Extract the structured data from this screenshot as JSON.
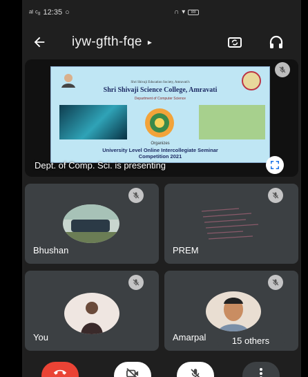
{
  "status_bar": {
    "signal": "ᵃᴵ ᶜₗₗ",
    "time": "12:35",
    "battery": "88"
  },
  "meeting": {
    "code": "iyw-gfth-fqe",
    "caret": "▸"
  },
  "presentation": {
    "presenter_label": "Dept. of Comp. Sci. is presenting",
    "slide": {
      "society": "Shri Shivaji Education Society, Amravati's",
      "college": "Shri Shivaji Science College, Amravati",
      "department": "Department of Computer Science",
      "organizer_label": "Organizes",
      "seminar_line1": "University Level Online Intercollegiate Seminar",
      "seminar_line2": "Competition 2021"
    }
  },
  "participants": [
    {
      "name": "Bhushan",
      "muted": true
    },
    {
      "name": "PREM",
      "muted": true
    },
    {
      "name": "You",
      "muted": true
    },
    {
      "name": "Amarpal",
      "muted": true
    }
  ],
  "others": "15 others",
  "controls": {
    "end_call": "end-call",
    "camera": "camera-off",
    "mic": "mic-off",
    "more": "more-options"
  },
  "colors": {
    "end_call": "#ea4335",
    "tile_bg": "#3c4043",
    "screen_bg": "#1f1f1f"
  }
}
